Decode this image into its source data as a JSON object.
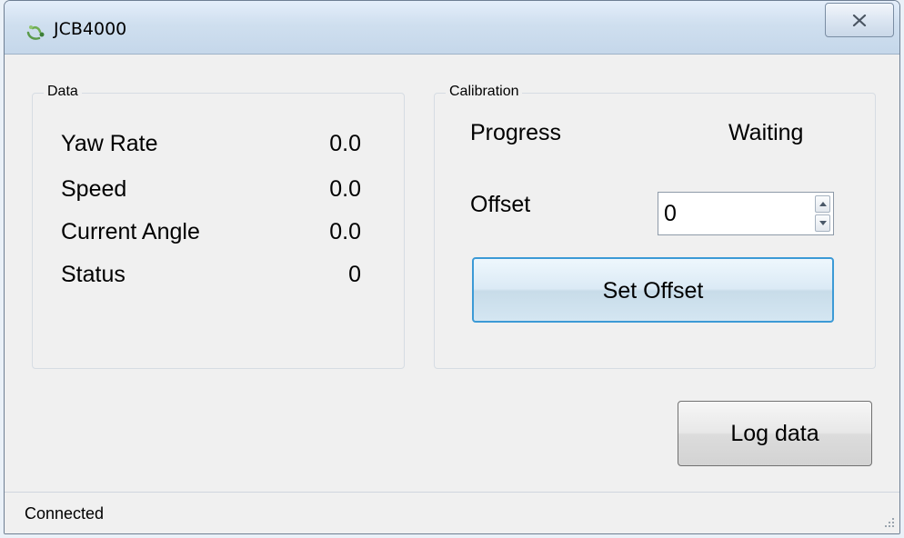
{
  "window": {
    "title": "JCB4000"
  },
  "data_group": {
    "title": "Data",
    "rows": [
      {
        "label": "Yaw Rate",
        "value": "0.0"
      },
      {
        "label": "Speed",
        "value": "0.0"
      },
      {
        "label": "Current Angle",
        "value": "0.0"
      },
      {
        "label": "Status",
        "value": "0"
      }
    ]
  },
  "calibration_group": {
    "title": "Calibration",
    "progress_label": "Progress",
    "progress_value": "Waiting",
    "offset_label": "Offset",
    "offset_value": "0",
    "set_offset_label": "Set Offset"
  },
  "log_data_label": "Log data",
  "status_bar": {
    "text": "Connected"
  },
  "icons": {
    "app": "app-icon",
    "close": "close-icon",
    "spin_up": "spin-up-icon",
    "spin_down": "spin-down-icon",
    "grip": "resize-grip-icon"
  },
  "colors": {
    "focus_border": "#3c9ad6",
    "window_bg": "#f0f0f0"
  }
}
